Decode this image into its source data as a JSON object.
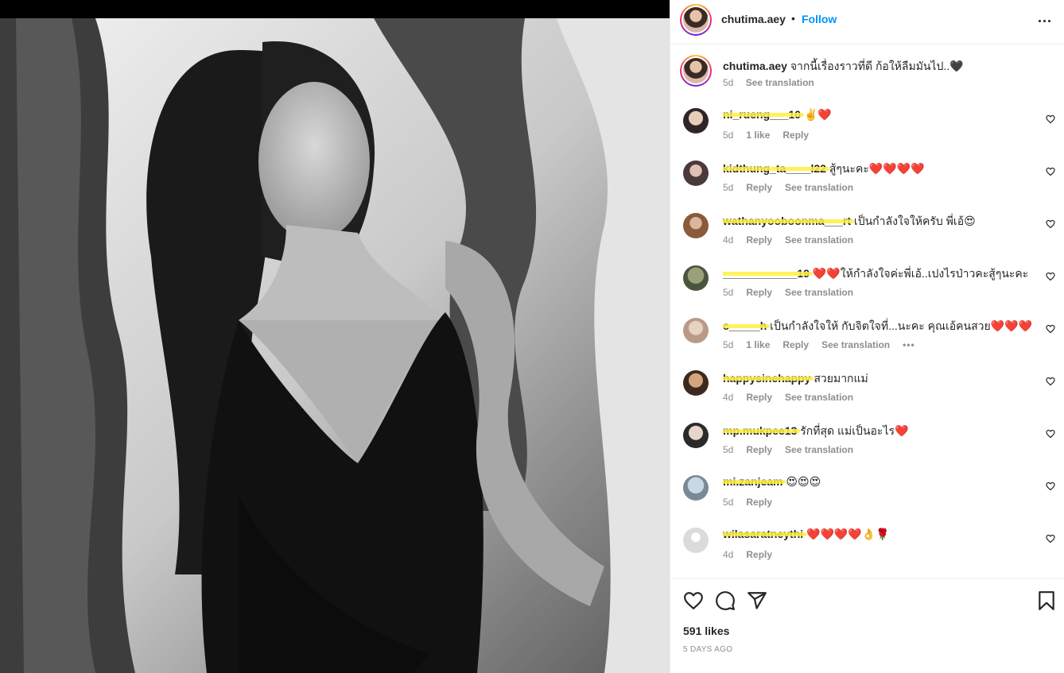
{
  "post": {
    "username": "chutima.aey",
    "separator": "•",
    "follow_label": "Follow",
    "more_icon": "more-horizontal-icon"
  },
  "caption": {
    "username": "chutima.aey",
    "text": "จากนี้เรื่องราวที่ดี ก้อให้ลืมมันไป..🖤",
    "time": "5d",
    "see_translation": "See translation"
  },
  "comments": [
    {
      "username": "ni_rueng___10",
      "text": " ✌️❤️",
      "time": "5d",
      "likes": "1 like",
      "reply": "Reply",
      "translation": ""
    },
    {
      "username": "kidthung_ta____l22",
      "text": " สู้ๆนะคะ❤️❤️❤️❤️",
      "time": "5d",
      "likes": "",
      "reply": "Reply",
      "translation": "See translation"
    },
    {
      "username": "wathanyooboonma___rt",
      "text": " เป็นกำลังใจให้ครับ พี่เอ้😍",
      "time": "4d",
      "likes": "",
      "reply": "Reply",
      "translation": "See translation"
    },
    {
      "username": "____________19",
      "text": " ❤️❤️ให้กำลังใจค่ะพี่เอ้..เปงไรป่าวคะสู้ๆนะคะ",
      "time": "5d",
      "likes": "",
      "reply": "Reply",
      "translation": "See translation"
    },
    {
      "username": "c_____h",
      "text": " เป็นกำลังใจให้ กับจิตใจที่...นะคะ คุณเอ้คนสวย❤️❤️❤️",
      "time": "5d",
      "likes": "1 like",
      "reply": "Reply",
      "translation": "See translation",
      "more": "•••"
    },
    {
      "username": "happysinehappy",
      "text": " สวยมากแม่",
      "time": "4d",
      "likes": "",
      "reply": "Reply",
      "translation": "See translation"
    },
    {
      "username": "mp.mukpee13",
      "text": " รักที่สุด แม่เป็นอะไร❤️",
      "time": "5d",
      "likes": "",
      "reply": "Reply",
      "translation": "See translation"
    },
    {
      "username": "mi.zanjeam",
      "text": " 😍😍😍",
      "time": "5d",
      "likes": "",
      "reply": "Reply",
      "translation": ""
    },
    {
      "username": "wilasaratneythi",
      "text": " ❤️❤️❤️❤️👌🌹",
      "time": "4d",
      "likes": "",
      "reply": "Reply",
      "translation": ""
    }
  ],
  "actions": {
    "like_icon": "heart-icon",
    "comment_icon": "comment-icon",
    "share_icon": "share-icon",
    "save_icon": "bookmark-icon"
  },
  "likes_count": "591 likes",
  "post_time": "5 DAYS AGO"
}
